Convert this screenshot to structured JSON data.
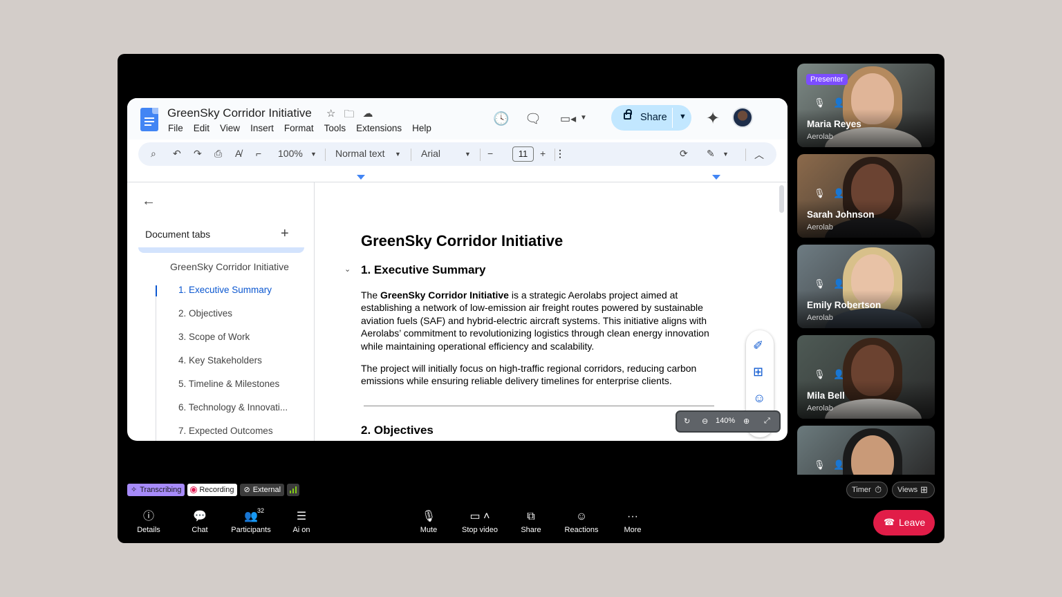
{
  "doc": {
    "title": "GreenSky Corridor Initiative",
    "menu": [
      "File",
      "Edit",
      "View",
      "Insert",
      "Format",
      "Tools",
      "Extensions",
      "Help"
    ],
    "share_label": "Share",
    "toolbar": {
      "zoom": "100%",
      "style": "Normal text",
      "font": "Arial",
      "font_size": "11"
    },
    "sidebar": {
      "title": "Document tabs",
      "tab_name": "GreenSky Corridor Initiative",
      "outline": [
        "1. Executive Summary",
        "2. Objectives",
        "3. Scope of Work",
        "4. Key Stakeholders",
        "5. Timeline & Milestones",
        "6. Technology & Innovati...",
        "7. Expected Outcomes"
      ]
    },
    "content": {
      "heading": "GreenSky Corridor Initiative",
      "section1": "1. Executive Summary",
      "p1_pre": "The ",
      "p1_bold": "GreenSky Corridor Initiative",
      "p1_post": " is a strategic Aerolabs project aimed at establishing a network of low-emission air freight routes powered by sustainable aviation fuels (SAF) and hybrid-electric aircraft systems. This initiative aligns with Aerolabs’ commitment to revolutionizing logistics through clean energy innovation while maintaining operational efficiency and scalability.",
      "p2": "The project will initially focus on high-traffic regional corridors, reducing carbon emissions while ensuring reliable delivery timelines for enterprise clients.",
      "section2": "2. Objectives"
    },
    "zoom_pill": "140%"
  },
  "participants": [
    {
      "name": "Maria Reyes",
      "org": "Aerolab",
      "presenter": "Presenter",
      "skin": "#e0b598",
      "hair": "#b58a5e",
      "bg": "#7d8a86",
      "cloth": "#e9e4dc"
    },
    {
      "name": "Sarah Johnson",
      "org": "Aerolab",
      "skin": "#6b4332",
      "hair": "#2a1c15",
      "bg": "#8c6a4b",
      "cloth": "#1f1f22"
    },
    {
      "name": "Emily Robertson",
      "org": "Aerolab",
      "skin": "#e8c2a6",
      "hair": "#d8c08a",
      "bg": "#6e7c83",
      "cloth": "#3d4753"
    },
    {
      "name": "Mila Bell",
      "org": "Aerolab",
      "skin": "#6b4230",
      "hair": "#3a2418",
      "bg": "#4e5a55",
      "cloth": "#e9e6e1"
    },
    {
      "name": "",
      "org": "",
      "skin": "#c99a78",
      "hair": "#1a1a1a",
      "bg": "#6b7a7d",
      "cloth": "#2b2f36"
    }
  ],
  "status_chips": {
    "transcribing": "Transcribing",
    "recording": "Recording",
    "external": "External"
  },
  "right_controls": {
    "timer": "Timer",
    "views": "Views"
  },
  "controls": {
    "details": "Details",
    "chat": "Chat",
    "participants": "Participants",
    "participants_count": "32",
    "ai": "Ai on",
    "mute": "Mute",
    "stop_video": "Stop video",
    "share": "Share",
    "reactions": "Reactions",
    "more": "More",
    "leave": "Leave"
  }
}
